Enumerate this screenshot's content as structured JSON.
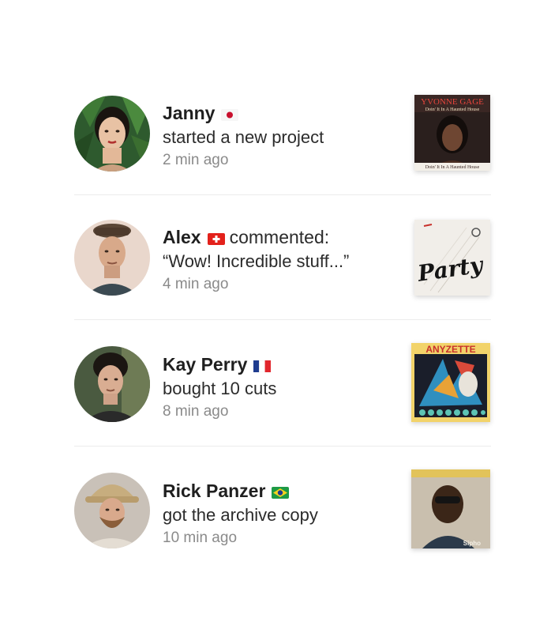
{
  "feed": {
    "items": [
      {
        "name": "Janny",
        "flag_icon": "japan-flag-icon",
        "action_inline": "",
        "action": "started a new project",
        "time": "2 min ago",
        "cover": {
          "title": "YVONNE GAGE",
          "subtitle": "Doin' It In A Haunted House",
          "subtitle2": "Doin' It In A Haunted House"
        }
      },
      {
        "name": "Alex",
        "flag_icon": "switzerland-flag-icon",
        "action_inline": "commented:",
        "action": "“Wow! Incredible stuff...”",
        "time": "4 min ago",
        "cover": {
          "title": "Party"
        }
      },
      {
        "name": "Kay Perry",
        "flag_icon": "france-flag-icon",
        "action_inline": "",
        "action": "bought 10 cuts",
        "time": "8 min ago",
        "cover": {
          "title": "ANYZETTE"
        }
      },
      {
        "name": "Rick Panzer",
        "flag_icon": "brazil-flag-icon",
        "action_inline": "",
        "action": "got the archive copy",
        "time": "10 min ago",
        "cover": {
          "title": "Sipho"
        }
      }
    ]
  }
}
